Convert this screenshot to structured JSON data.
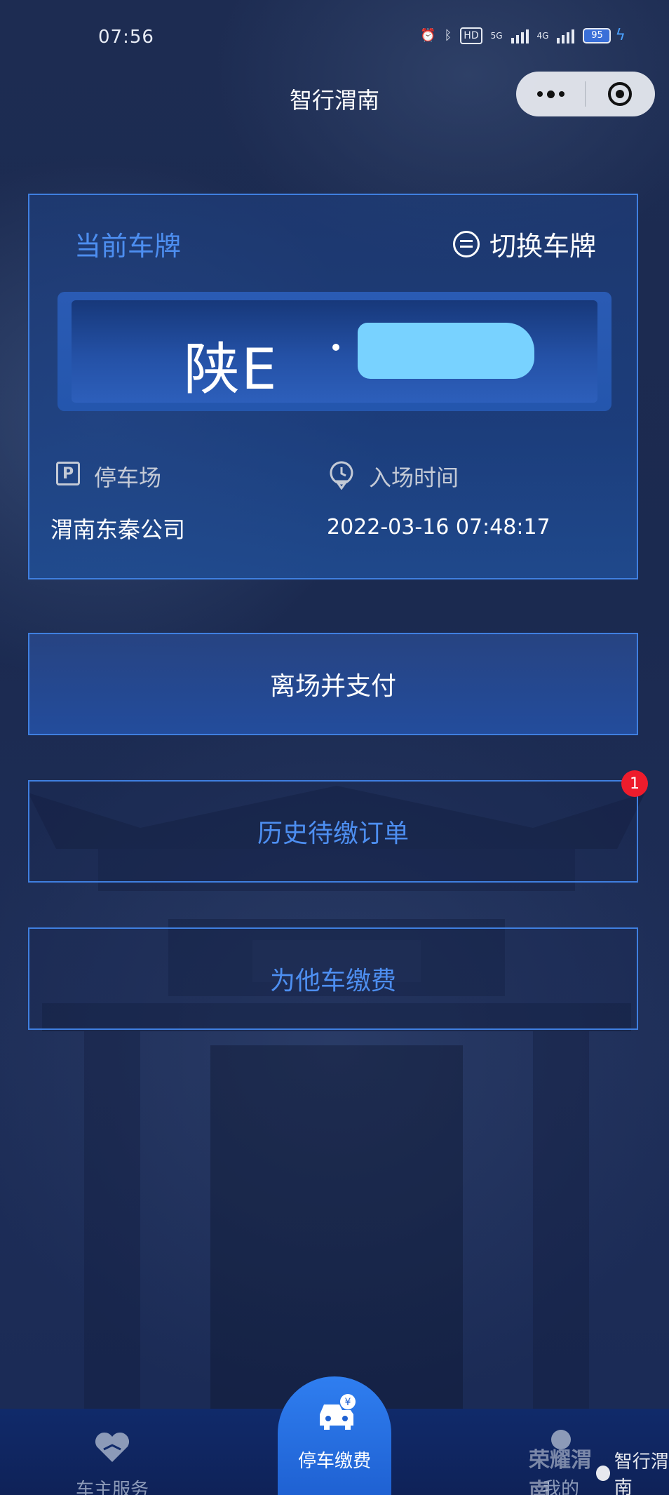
{
  "status_bar": {
    "time": "07:56",
    "battery": "95",
    "hd": "HD",
    "network_1": "5G",
    "network_2": "4G"
  },
  "header": {
    "title": "智行渭南"
  },
  "plate_card": {
    "current_plate_label": "当前车牌",
    "switch_label": "切换车牌",
    "plate_prefix": "陕E",
    "parking_lot_label": "停车场",
    "entry_time_label": "入场时间",
    "parking_lot_value": "渭南东秦公司",
    "entry_time_value": "2022-03-16 07:48:17",
    "parking_icon": "P"
  },
  "actions": {
    "leave_and_pay": "离场并支付",
    "history_orders": "历史待缴订单",
    "history_badge": "1",
    "pay_for_other": "为他车缴费"
  },
  "bottom_nav": {
    "owner_service": "车主服务",
    "parking_pay": "停车缴费",
    "mine": "我的"
  },
  "watermark": {
    "text": "智行渭南",
    "brand": "荣耀渭南"
  },
  "colors": {
    "accent": "#4d8ef0",
    "border": "#3f7fe0",
    "badge": "#ee1c2c",
    "plate_mask": "#78d2ff"
  }
}
